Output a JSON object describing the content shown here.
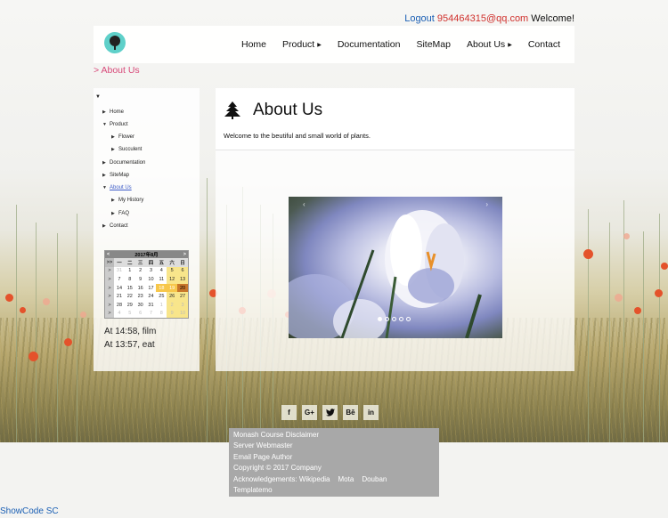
{
  "top_links": {
    "logout": "Logout",
    "email": "954464315@qq.com",
    "welcome": "Welcome!"
  },
  "nav": {
    "items": [
      {
        "label": "Home",
        "has_submenu": false
      },
      {
        "label": "Product",
        "has_submenu": true
      },
      {
        "label": "Documentation",
        "has_submenu": false
      },
      {
        "label": "SiteMap",
        "has_submenu": false
      },
      {
        "label": "About Us",
        "has_submenu": true
      },
      {
        "label": "Contact",
        "has_submenu": false
      }
    ]
  },
  "breadcrumb": "> About Us",
  "tree": {
    "items": [
      {
        "label": "Home"
      },
      {
        "label": "Product"
      },
      {
        "label": "Flower"
      },
      {
        "label": "Succulent"
      },
      {
        "label": "Documentation"
      },
      {
        "label": "SiteMap"
      },
      {
        "label": "About Us"
      },
      {
        "label": "My History"
      },
      {
        "label": "FAQ"
      },
      {
        "label": "Contact"
      }
    ]
  },
  "calendar": {
    "prev": "<",
    "prev_year": ">>",
    "title": "2017年8月",
    "next": ">",
    "weekdays": [
      "一",
      "二",
      "三",
      "四",
      "五",
      "六",
      "日"
    ],
    "weeks": [
      [
        ">",
        "31",
        "1",
        "2",
        "3",
        "4",
        "5",
        "6"
      ],
      [
        ">",
        "7",
        "8",
        "9",
        "10",
        "11",
        "12",
        "13"
      ],
      [
        ">",
        "14",
        "15",
        "16",
        "17",
        "18",
        "19",
        "20"
      ],
      [
        ">",
        "21",
        "22",
        "23",
        "24",
        "25",
        "26",
        "27"
      ],
      [
        ">",
        "28",
        "29",
        "30",
        "31",
        "1",
        "2",
        "3"
      ],
      [
        ">",
        "4",
        "5",
        "6",
        "7",
        "8",
        "9",
        "10"
      ]
    ],
    "selected_day": "20"
  },
  "reminders": [
    "At 14:58, film",
    "At 13:57, eat"
  ],
  "main": {
    "title": "About Us",
    "intro": "Welcome to the beutiful and small world of plants."
  },
  "carousel": {
    "prev_label": "‹",
    "next_label": "›",
    "slide_count": 5,
    "active_slide": 1
  },
  "social": {
    "facebook": "f",
    "googleplus": "G+",
    "twitter": "t",
    "behance": "Bē",
    "linkedin": "in"
  },
  "footer": {
    "disclaimer": "Monash Course Disclaimer",
    "webmaster": "Server Webmaster",
    "author": "Email Page Author",
    "copyright": "Copyright © 2017 Company",
    "ack_label": "Acknowledgements:",
    "ack_links": [
      "Wikipedia",
      "Mota",
      "Douban"
    ],
    "templatemo": "Templatemo"
  },
  "showcode": "ShowCode SC",
  "colors": {
    "link_blue": "#1a5fb4",
    "email_red": "#d0312d",
    "breadcrumb_pink": "#d84a7a",
    "calendar_selected": "#c8762a",
    "footer_bg": "#a8a8a8"
  }
}
